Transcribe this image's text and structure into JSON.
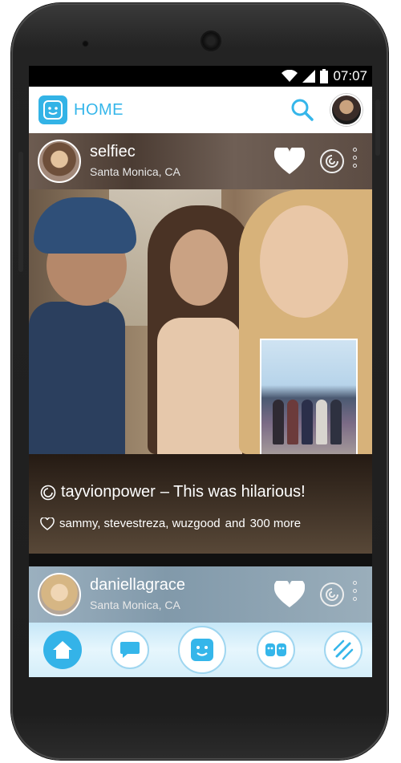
{
  "status_bar": {
    "time": "07:07",
    "icons": [
      "wifi-icon",
      "signal-icon",
      "battery-icon"
    ]
  },
  "app_bar": {
    "title": "HOME",
    "icons": [
      "app-logo-icon",
      "search-icon"
    ]
  },
  "posts": [
    {
      "username": "selfiec",
      "location": "Santa Monica, CA",
      "caption_user": "tayvionpower",
      "caption_text": "– This was hilarious!",
      "likes_names": "sammy, stevestreza, wuzgood",
      "likes_conj": "and",
      "likes_more": "300 more"
    },
    {
      "username": "daniellagrace",
      "location": "Santa Monica, CA"
    }
  ],
  "bottom_nav": {
    "icons": [
      "home-icon",
      "chat-icon",
      "selfie-camera-icon",
      "friends-icon",
      "settings-icon"
    ]
  },
  "colors": {
    "accent": "#35b6ea",
    "nav_background": "#d4eef9"
  }
}
